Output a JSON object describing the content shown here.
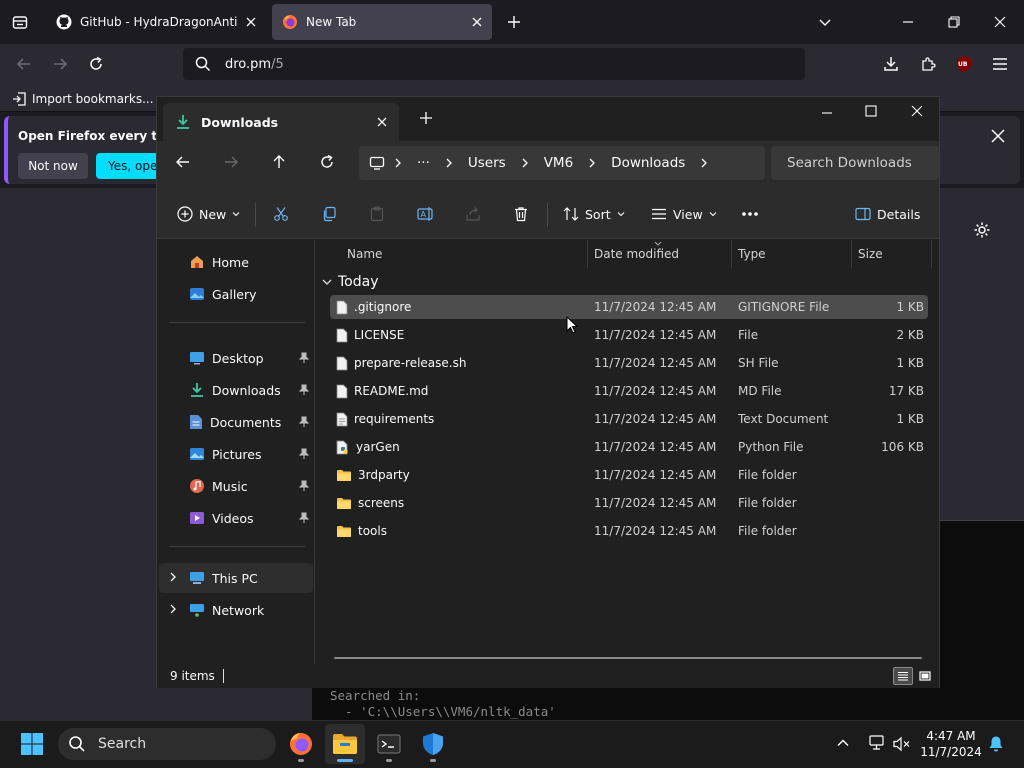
{
  "firefox": {
    "tabs": [
      {
        "title": "GitHub - HydraDragonAntivirus"
      },
      {
        "title": "New Tab"
      }
    ],
    "url": {
      "host": "dro.pm",
      "path": "/5"
    },
    "bookmarks": {
      "import_label": "Import bookmarks..."
    },
    "banner": {
      "text": "Open Firefox every time",
      "not_now": "Not now",
      "yes": "Yes, open"
    },
    "extension_badge": "UB"
  },
  "terminal": {
    "lines": [
      "Searched in:",
      "  - 'C:\\\\Users\\\\VM6/nltk_data'"
    ]
  },
  "explorer": {
    "tab_title": "Downloads",
    "breadcrumb": [
      "Users",
      "VM6",
      "Downloads"
    ],
    "search_placeholder": "Search Downloads",
    "toolbar": {
      "new": "New",
      "sort": "Sort",
      "view": "View",
      "details": "Details"
    },
    "nav": {
      "home": "Home",
      "gallery": "Gallery",
      "quick": [
        "Desktop",
        "Downloads",
        "Documents",
        "Pictures",
        "Music",
        "Videos"
      ],
      "this_pc": "This PC",
      "network": "Network"
    },
    "columns": {
      "name": "Name",
      "date": "Date modified",
      "type": "Type",
      "size": "Size"
    },
    "group": "Today",
    "files": [
      {
        "name": ".gitignore",
        "date": "11/7/2024 12:45 AM",
        "type": "GITIGNORE File",
        "size": "1 KB",
        "icon": "file-icon"
      },
      {
        "name": "LICENSE",
        "date": "11/7/2024 12:45 AM",
        "type": "File",
        "size": "2 KB",
        "icon": "file-icon"
      },
      {
        "name": "prepare-release.sh",
        "date": "11/7/2024 12:45 AM",
        "type": "SH File",
        "size": "1 KB",
        "icon": "file-icon"
      },
      {
        "name": "README.md",
        "date": "11/7/2024 12:45 AM",
        "type": "MD File",
        "size": "17 KB",
        "icon": "file-icon"
      },
      {
        "name": "requirements",
        "date": "11/7/2024 12:45 AM",
        "type": "Text Document",
        "size": "1 KB",
        "icon": "text-file-icon"
      },
      {
        "name": "yarGen",
        "date": "11/7/2024 12:45 AM",
        "type": "Python File",
        "size": "106 KB",
        "icon": "python-file-icon"
      },
      {
        "name": "3rdparty",
        "date": "11/7/2024 12:45 AM",
        "type": "File folder",
        "size": "",
        "icon": "folder-icon"
      },
      {
        "name": "screens",
        "date": "11/7/2024 12:45 AM",
        "type": "File folder",
        "size": "",
        "icon": "folder-icon"
      },
      {
        "name": "tools",
        "date": "11/7/2024 12:45 AM",
        "type": "File folder",
        "size": "",
        "icon": "folder-icon"
      }
    ],
    "status": "9 items"
  },
  "taskbar": {
    "search_label": "Search",
    "time": "4:47 AM",
    "date": "11/7/2024"
  },
  "colors": {
    "accent": "#00ddff",
    "folder": "#f2c44d",
    "explorer_bg": "#202020",
    "taskbar_active": "#5fb2f2"
  }
}
